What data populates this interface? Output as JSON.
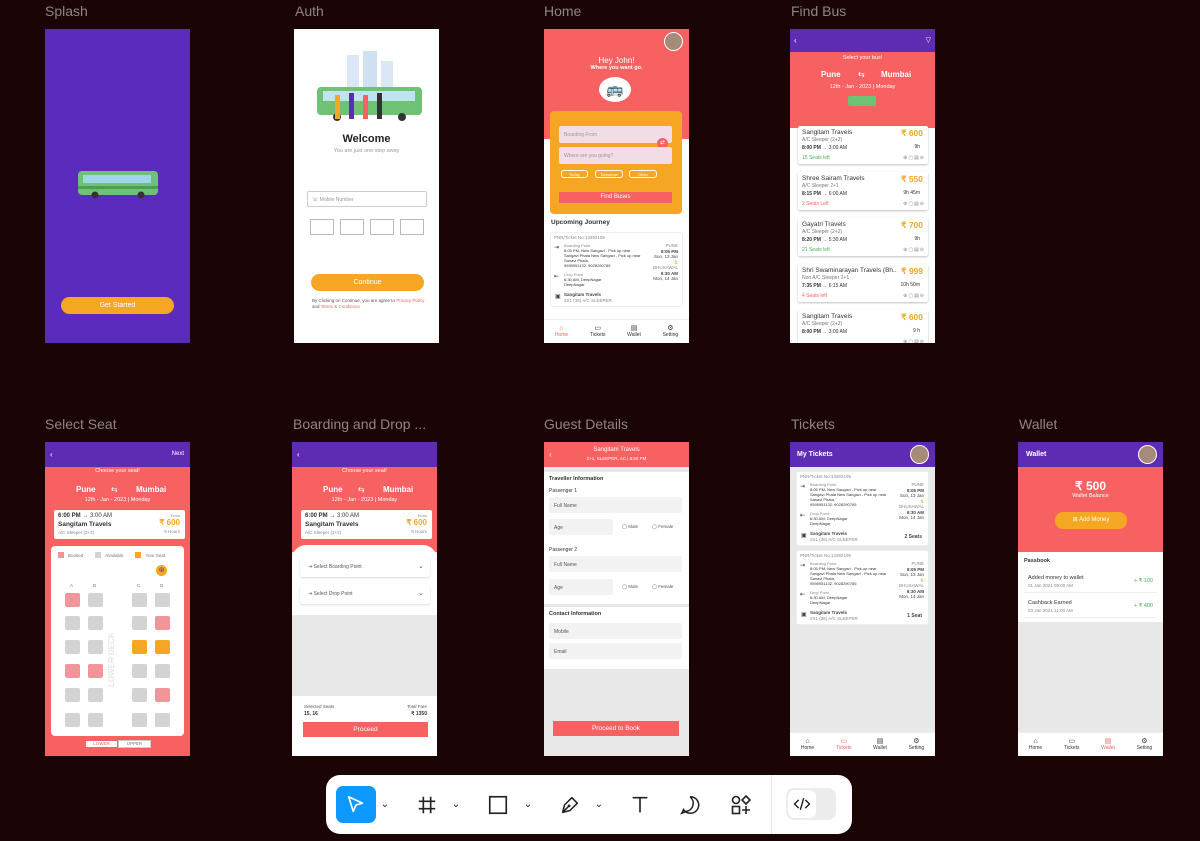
{
  "frames": {
    "splash": {
      "label": "Splash",
      "cta": "Get Started"
    },
    "auth": {
      "label": "Auth",
      "title": "Welcome",
      "subtitle": "You are just one step away",
      "phone_placeholder": "Mobile Number",
      "cta": "Continue",
      "legal_prefix": "By Clicking on Continue, you are agree to",
      "privacy": "Privacy Policy",
      "and": "and",
      "terms": "Terms & Conditions"
    },
    "home": {
      "label": "Home",
      "greeting": "Hey John!",
      "subgreeting": "Where you want go.",
      "boarding_from": "Boarding From",
      "where_to": "Where are you going?",
      "chip_today": "Today",
      "chip_tomorrow": "Tomorrow",
      "chip_other": "Other",
      "find_buses": "Find Buses",
      "upcoming": "Upcoming Journey",
      "pnr": "PNR/Ticket No:13392109",
      "boarding_point_label": "Boarding Point",
      "boarding_point": "8:05 PM, New Sangavi - Pick up near Sangavi Phata New Sangavi - Pick up near Sanavi Phata,",
      "boarding_phone": "9595951132, 9028290785",
      "drop_point_label": "Drop Point",
      "drop_point": "6:30 AM, DeepNagar",
      "drop_place": "DeepNagar",
      "from_city": "PUNE",
      "from_time": "8:05 PM",
      "from_date": "Sun, 13 Jan",
      "to_city": "BHUSAWAL",
      "to_time": "6:30 AM",
      "to_date": "Mon, 14 Jan",
      "operator": "Sangitam Travels",
      "operator_detail": "2X1 (36) A/C SLEEPER"
    },
    "find_bus": {
      "label": "Find Bus",
      "heading": "Select your bus!",
      "from": "Pune",
      "to": "Mumbai",
      "date": "12th - Jan - 2023 | Monday",
      "buses": [
        {
          "name": "Sangitam Travels",
          "type": "A/C Sleeper (2+2)",
          "price": "₹ 600",
          "dep": "8:00 PM",
          "arr": "3:00 AM",
          "dur": "9h",
          "left": "15 Seats left",
          "left_color": "#4caf50"
        },
        {
          "name": "Shree Sairam Travels",
          "type": "A/C Sleeper 2+1",
          "price": "₹ 550",
          "dep": "8:15 PM",
          "arr": "6:00 AM",
          "dur": "9h 45m",
          "left": "2 Seats Left",
          "left_color": "#f76162"
        },
        {
          "name": "Gayatri Travels",
          "type": "A/C Sleeper (2+2)",
          "price": "₹ 700",
          "dep": "8:20 PM",
          "arr": "5:30 AM",
          "dur": "9h",
          "left": "21 Seats left",
          "left_color": "#4caf50"
        },
        {
          "name": "Shri Swaminarayan Travels (Bh..",
          "type": "Non A/C Sleeper 2+1",
          "price": "₹ 999",
          "dep": "7:35 PM",
          "arr": "6:15 AM",
          "dur": "10h 50m",
          "left": "4 Seats left",
          "left_color": "#f76162"
        },
        {
          "name": "Sangitam Travels",
          "type": "A/C Sleeper (2+2)",
          "price": "₹ 600",
          "dep": "8:00 PM",
          "arr": "3:00 AM",
          "dur": "9 h",
          "left": "",
          "left_color": "#4caf50"
        }
      ]
    },
    "select_seat": {
      "label": "Select Seat",
      "next": "Next",
      "heading": "Choose your seat!",
      "from": "Pune",
      "to": "Mumbai",
      "date": "12th - Jan - 2023 | Monday",
      "dep": "6:00 PM",
      "arr": "3:00 AM",
      "operator": "Sangitam Travels",
      "type": "A/C Sleeper (2+2)",
      "from_label": "From",
      "price": "₹ 600",
      "hours": "9 Hours",
      "legend_booked": "Booked",
      "legend_available": "Available",
      "legend_your": "Your Seat",
      "col_a": "A",
      "col_b": "B",
      "col_c": "C",
      "col_d": "D",
      "deck": "LOWER DECK",
      "tab_lower": "LOWER",
      "tab_upper": "UPPER"
    },
    "boarding": {
      "label": "Boarding and Drop ...",
      "heading": "Choose your seat!",
      "from": "Pune",
      "to": "Mumbai",
      "date": "12th - Jan - 2023 | Monday",
      "dep": "6:00 PM",
      "arr": "3:00 AM",
      "operator": "Sangitam Travels",
      "type": "A/C Sleeper (2+2)",
      "from_label": "From",
      "price": "₹ 600",
      "hours": "9 Hours",
      "select_boarding": "Select Boarding Point",
      "select_drop": "Select Drop Point",
      "selected_seats_label": "Selected Seats",
      "selected_seats": "15, 16",
      "total_fare_label": "Total Fare",
      "total_fare": "₹ 1350",
      "cta": "Proceed"
    },
    "guest": {
      "label": "Guest Details",
      "title": "Sangitam Travels",
      "subtitle": "2+1, SLEEPER, AC | 8:50 PM",
      "traveller_info": "Traveller Information",
      "passenger1": "Passenger 1",
      "passenger2": "Passenger 2",
      "full_name": "Full Name",
      "age": "Age",
      "male": "Male",
      "female": "Female",
      "contact": "Contact Information",
      "mobile": "Mobile",
      "email": "Email",
      "cta": "Proceed to Book"
    },
    "tickets": {
      "label": "Tickets",
      "title": "My Tickets",
      "items": [
        {
          "pnr": "PNR/Ticket No:13392109",
          "seats": "2 Seats"
        },
        {
          "pnr": "PNR/Ticket No:13392109",
          "seats": "1 Seat"
        }
      ]
    },
    "wallet": {
      "label": "Wallet",
      "title": "Wallet",
      "amount": "₹ 500",
      "balance_label": "Wallet Balance",
      "add_money": "Add Money",
      "passbook": "Passbook",
      "entries": [
        {
          "title": "Added money to wallet",
          "date": "01 Jan 2021 09:00 AM",
          "amount": "+ ₹ 100"
        },
        {
          "title": "Cashback Earned",
          "date": "03 Jan 2021 11:00 AM",
          "amount": "+ ₹ 400"
        }
      ]
    }
  },
  "nav": {
    "home": "Home",
    "tickets": "Tickets",
    "wallet": "Wallet",
    "setting": "Setting"
  },
  "colors": {
    "purple": "#5b2bbd",
    "coral": "#f76162",
    "orange": "#f5a623",
    "canvas": "#1a0405",
    "tool_active": "#0d99ff"
  },
  "toolbar": {
    "active_tool": "move-tool",
    "icons": [
      "cursor-icon",
      "frame-icon",
      "rectangle-icon",
      "pen-icon",
      "text-icon",
      "comment-icon",
      "components-icon",
      "code-icon"
    ]
  }
}
